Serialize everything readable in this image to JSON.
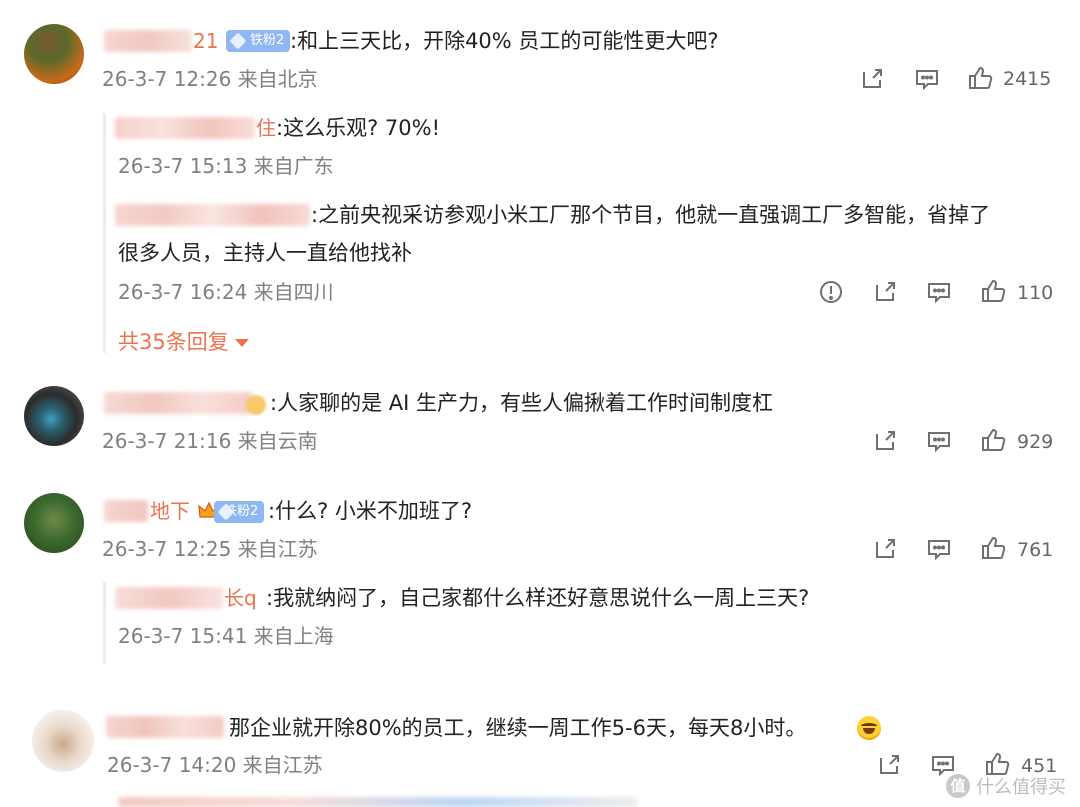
{
  "comments": [
    {
      "name_suffix": "21",
      "badge": "铁粉2",
      "text": ":和上三天比，开除40% 员工的可能性更大吧?",
      "meta": "26-3-7 12:26 来自北京",
      "likes": "2415",
      "replies": [
        {
          "name_suffix": "住",
          "text": ":这么乐观? 70%!",
          "meta": "26-3-7 15:13 来自广东"
        },
        {
          "name_suffix": "",
          "text_line1": ":之前央视采访参观小米工厂那个节目，他就一直强调工厂多智能，省掉了",
          "text_line2": "很多人员，主持人一直给他找补",
          "meta": "26-3-7 16:24 来自四川",
          "likes": "110"
        }
      ],
      "more_replies": "共35条回复"
    },
    {
      "name_suffix": "",
      "text": ":人家聊的是 AI 生产力，有些人偏揪着工作时间制度杠",
      "meta": "26-3-7 21:16 来自云南",
      "likes": "929"
    },
    {
      "name_suffix": "地下",
      "badge": "铁粉2",
      "text": ":什么? 小米不加班了?",
      "meta": "26-3-7 12:25 来自江苏",
      "likes": "761",
      "replies": [
        {
          "name_suffix": "长q",
          "text": ":我就纳闷了，自己家都什么样还好意思说什么一周上三天?",
          "meta": "26-3-7 15:41 来自上海"
        }
      ]
    },
    {
      "name_suffix": "",
      "text": "那企业就开除80%的员工，继续一周工作5-6天，每天8小时。",
      "meta": "26-3-7 14:20 来自江苏",
      "likes": "451"
    }
  ],
  "watermark": {
    "logo": "值",
    "text": "什么值得买"
  },
  "icons": {
    "share": "share-icon",
    "comment": "comment-icon",
    "like": "thumbs-up-icon",
    "report": "report-icon"
  },
  "colors": {
    "name": "#eb7350",
    "meta": "#808080",
    "badge": "#8fb8f2"
  }
}
